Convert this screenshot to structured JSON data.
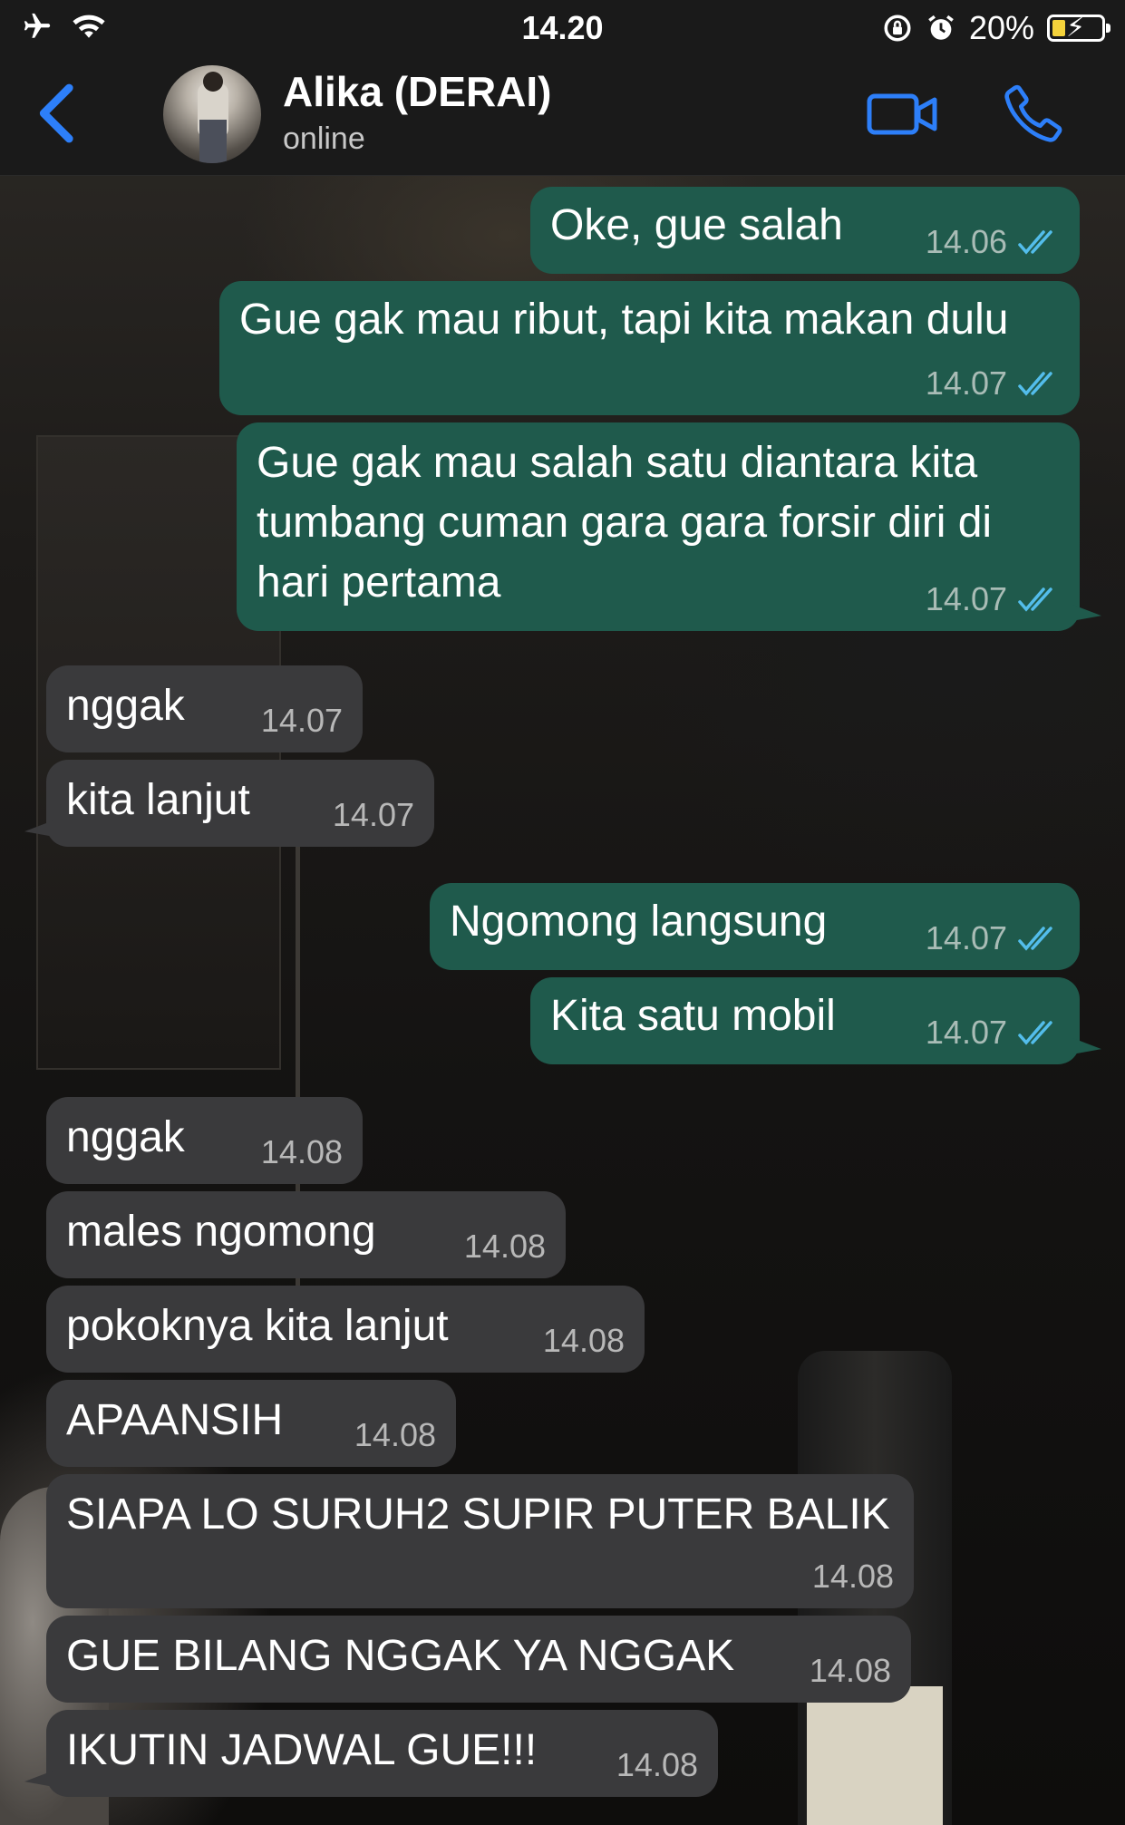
{
  "status_bar": {
    "time": "14.20",
    "battery": "20%",
    "icons": [
      "airplane-icon",
      "wifi-icon",
      "rotation-lock-icon",
      "alarm-icon",
      "battery-charging-icon"
    ]
  },
  "header": {
    "contact_name": "Alika (DERAI)",
    "status": "online",
    "accent_color": "#2d7ff9"
  },
  "colors": {
    "outgoing_bubble": "#1f5a4c",
    "incoming_bubble": "#3a3a3c",
    "read_ticks": "#53bdeb"
  },
  "messages": [
    {
      "direction": "out",
      "text": "Oke, gue salah",
      "time": "14.06",
      "read": true
    },
    {
      "direction": "out",
      "text": "Gue gak mau ribut, tapi kita makan dulu",
      "time": "14.07",
      "read": true
    },
    {
      "direction": "out",
      "text": "Gue gak mau salah satu diantara kita tumbang cuman gara gara forsir diri di hari pertama",
      "time": "14.07",
      "read": true
    },
    {
      "direction": "in",
      "text": "nggak",
      "time": "14.07"
    },
    {
      "direction": "in",
      "text": "kita lanjut",
      "time": "14.07"
    },
    {
      "direction": "out",
      "text": "Ngomong langsung",
      "time": "14.07",
      "read": true
    },
    {
      "direction": "out",
      "text": "Kita satu mobil",
      "time": "14.07",
      "read": true
    },
    {
      "direction": "in",
      "text": "nggak",
      "time": "14.08"
    },
    {
      "direction": "in",
      "text": "males ngomong",
      "time": "14.08"
    },
    {
      "direction": "in",
      "text": "pokoknya kita lanjut",
      "time": "14.08"
    },
    {
      "direction": "in",
      "text": "APAANSIH",
      "time": "14.08"
    },
    {
      "direction": "in",
      "text": "SIAPA LO SURUH2 SUPIR PUTER BALIK",
      "time": "14.08"
    },
    {
      "direction": "in",
      "text": "GUE BILANG NGGAK YA NGGAK",
      "time": "14.08"
    },
    {
      "direction": "in",
      "text": "IKUTIN JADWAL GUE!!!",
      "time": "14.08"
    }
  ]
}
